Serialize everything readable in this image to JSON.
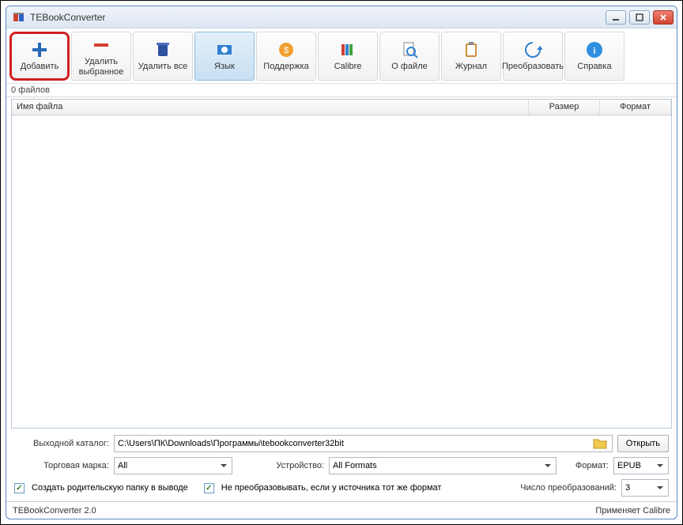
{
  "title": "TEBookConverter",
  "toolbar": {
    "add": "Добавить",
    "remove": "Удалить выбранное",
    "removeAll": "Удалить все",
    "language": "Язык",
    "support": "Поддержка",
    "calibre": "Calibre",
    "about": "О файле",
    "log": "Журнал",
    "convert": "Преобразовать",
    "help": "Справка"
  },
  "fileCount": "0 файлов",
  "columns": {
    "name": "Имя файла",
    "size": "Размер",
    "format": "Формат"
  },
  "labels": {
    "outputDir": "Выходной каталог:",
    "brand": "Торговая марка:",
    "device": "Устройство:",
    "format": "Формат:",
    "threads": "Число преобразований:",
    "open": "Открыть"
  },
  "values": {
    "outputDir": "C:\\Users\\ПК\\Downloads\\Программы\\tebookconverter32bit",
    "brand": "All",
    "device": "All Formats",
    "format": "EPUB",
    "threads": "3"
  },
  "checks": {
    "createParent": "Создать родительскую папку в выводе",
    "skipSame": "Не преобразовывать, если у источника тот же формат"
  },
  "status": {
    "left": "TEBookConverter 2.0",
    "right": "Применяет Calibre"
  }
}
